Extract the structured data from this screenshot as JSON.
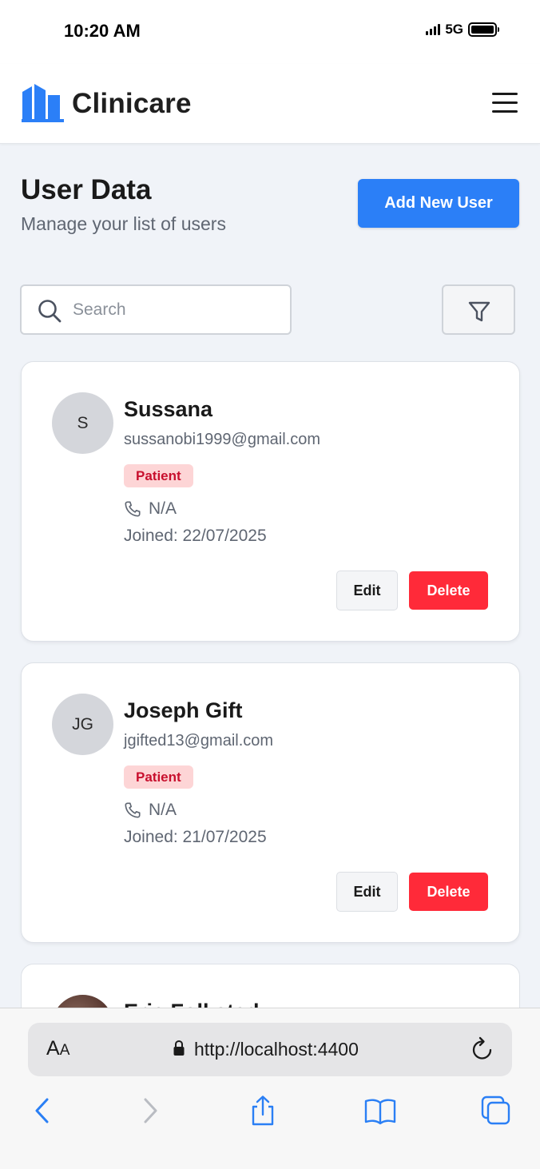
{
  "status_bar": {
    "time": "10:20 AM",
    "network": "5G"
  },
  "header": {
    "brand": "Clinicare",
    "logo_icon": "building-icon",
    "menu_icon": "hamburger-menu-icon",
    "brand_color": "#2b7ff7"
  },
  "page": {
    "title": "User Data",
    "subtitle": "Manage your list of users",
    "add_button_label": "Add New User"
  },
  "search": {
    "placeholder": "Search",
    "value": "",
    "filter_icon": "filter-icon"
  },
  "users": [
    {
      "initials": "S",
      "name": "Sussana",
      "email": "sussanobi1999@gmail.com",
      "role": "Patient",
      "phone": "N/A",
      "joined": "Joined: 22/07/2025",
      "edit_label": "Edit",
      "delete_label": "Delete"
    },
    {
      "initials": "JG",
      "name": "Joseph Gift",
      "email": "jgifted13@gmail.com",
      "role": "Patient",
      "phone": "N/A",
      "joined": "Joined: 21/07/2025",
      "edit_label": "Edit",
      "delete_label": "Delete"
    },
    {
      "name": "Eric Folkstad"
    }
  ],
  "browser": {
    "text_size_label_large": "A",
    "text_size_label_small": "A",
    "url": "http://localhost:4400"
  },
  "colors": {
    "delete": "#ff2a39",
    "badge_bg": "#fdd5d6",
    "badge_text": "#c8102e",
    "ios_blue": "#2a7ff5"
  }
}
